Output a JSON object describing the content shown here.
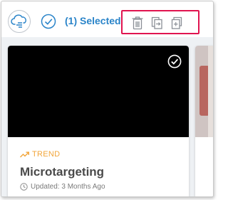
{
  "toolbar": {
    "selected_label": "(1) Selected",
    "actions": [
      {
        "name": "delete",
        "icon": "trash-icon"
      },
      {
        "name": "move",
        "icon": "move-to-icon"
      },
      {
        "name": "duplicate",
        "icon": "duplicate-icon"
      }
    ],
    "highlight_color": "#e0144f",
    "accent_color": "#2a84c9"
  },
  "cards": [
    {
      "category": "TREND",
      "category_icon": "trend-up-icon",
      "title": "Microtargeting",
      "updated": "Updated: 3 Months Ago",
      "selected": true
    }
  ]
}
